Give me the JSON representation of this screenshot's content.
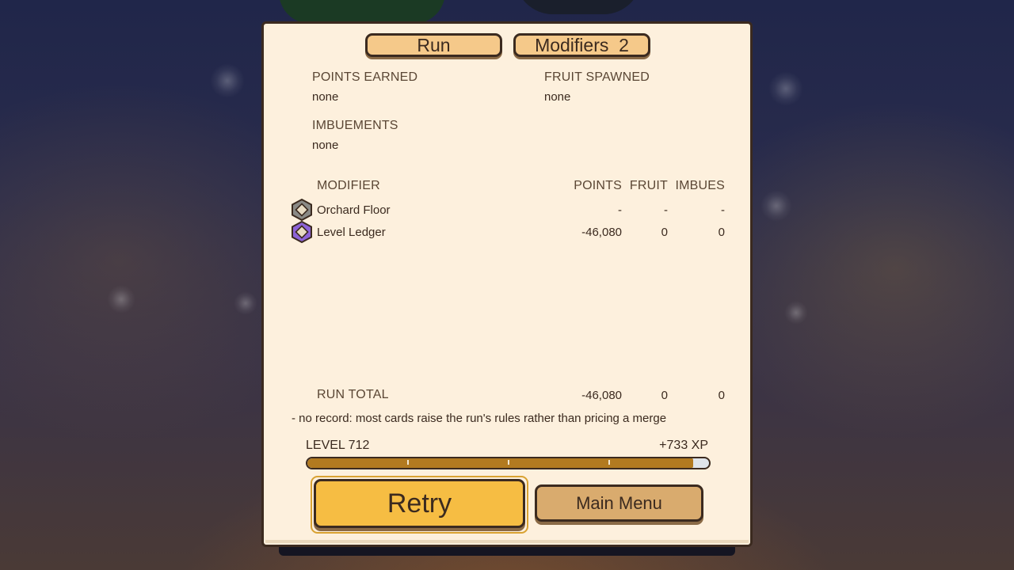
{
  "tabs": {
    "run_label": "Run",
    "modifiers_label": "Modifiers  2"
  },
  "summary": {
    "points_earned_label": "POINTS EARNED",
    "points_earned_value": "none",
    "fruit_spawned_label": "FRUIT SPAWNED",
    "fruit_spawned_value": "none",
    "imbuements_label": "IMBUEMENTS",
    "imbuements_value": "none"
  },
  "table": {
    "headers": {
      "modifier": "MODIFIER",
      "points": "POINTS",
      "fruit": "FRUIT",
      "imbues": "IMBUES"
    },
    "rows": [
      {
        "icon": "gray-hexagon-diamond-icon",
        "icon_color": "#8a8a86",
        "name": "Orchard Floor",
        "points": "-",
        "fruit": "-",
        "imbues": "-"
      },
      {
        "icon": "purple-hexagon-diamond-icon",
        "icon_color": "#8c63d8",
        "name": "Level Ledger",
        "points": "-46,080",
        "fruit": "0",
        "imbues": "0"
      }
    ],
    "total": {
      "label": "RUN TOTAL",
      "points": "-46,080",
      "fruit": "0",
      "imbues": "0"
    }
  },
  "note": "-  no record: most cards raise the run's rules rather than pricing a merge",
  "level": {
    "label": "LEVEL 712",
    "xp_gain": "+733 XP",
    "progress": 0.96
  },
  "buttons": {
    "retry": "Retry",
    "main_menu": "Main Menu"
  },
  "colors": {
    "panel": "#fdf0dd",
    "accent": "#f6bd43",
    "xp_fill": "#b27a20",
    "border": "#3b2a1f"
  }
}
